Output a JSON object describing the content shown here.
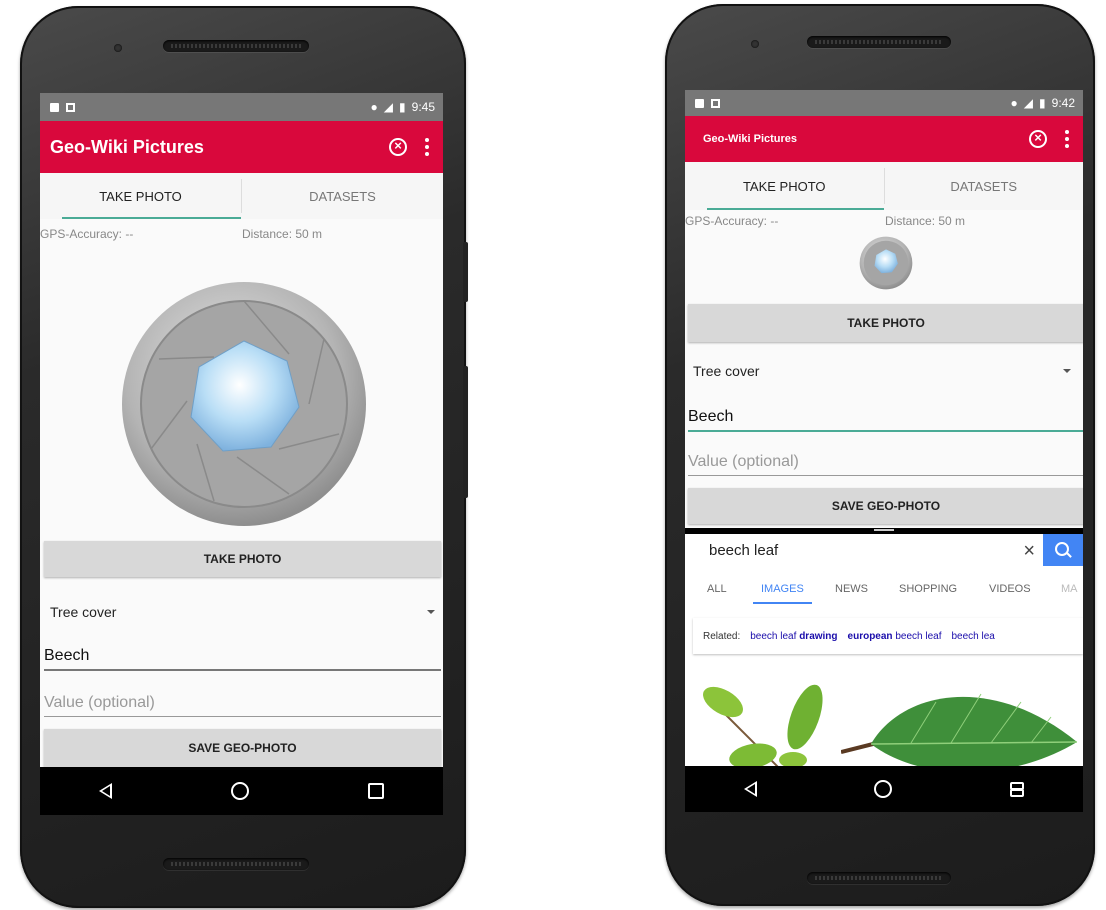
{
  "left_phone": {
    "status_time": "9:45",
    "app_title": "Geo-Wiki Pictures",
    "tabs": [
      "TAKE PHOTO",
      "DATASETS"
    ],
    "gps_accuracy": "GPS-Accuracy: --",
    "distance": "Distance: 50 m",
    "take_photo_button": "TAKE PHOTO",
    "category_select": "Tree cover",
    "species_field": "Beech",
    "value_placeholder": "Value (optional)",
    "save_button": "SAVE GEO-PHOTO"
  },
  "right_phone": {
    "status_time": "9:42",
    "app_title": "Geo-Wiki Pictures",
    "tabs": [
      "TAKE PHOTO",
      "DATASETS"
    ],
    "gps_accuracy": "GPS-Accuracy: --",
    "distance": "Distance: 50 m",
    "take_photo_button": "TAKE PHOTO",
    "category_select": "Tree cover",
    "species_field": "Beech",
    "value_placeholder": "Value (optional)",
    "save_button": "SAVE GEO-PHOTO",
    "browser": {
      "query": "beech leaf",
      "tabs": [
        "ALL",
        "IMAGES",
        "NEWS",
        "SHOPPING",
        "VIDEOS",
        "MA"
      ],
      "related_label": "Related:",
      "related": [
        {
          "plain": "beech leaf ",
          "bold": "drawing"
        },
        {
          "bold": "european",
          "plain": " beech leaf"
        },
        {
          "plain": "beech lea",
          "bold": ""
        }
      ]
    }
  },
  "colors": {
    "appbar": "#d9083c",
    "tab_indicator": "#4aab96",
    "google_blue": "#4285f4"
  }
}
